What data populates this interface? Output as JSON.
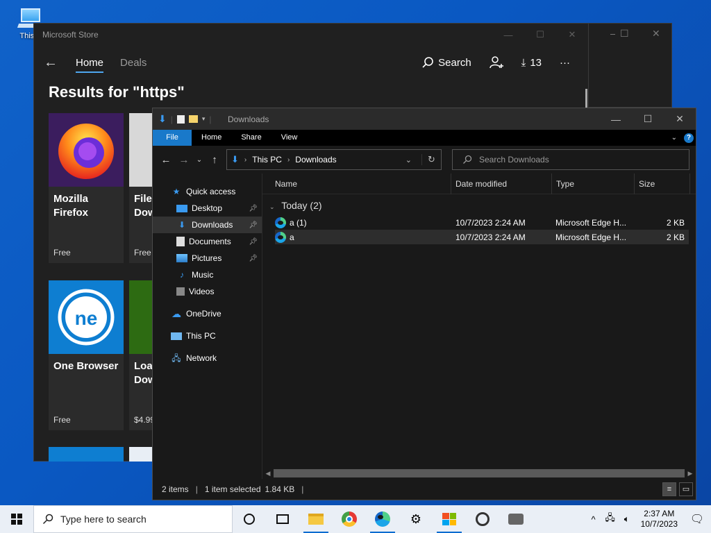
{
  "desktop": {
    "icon_label": "This P"
  },
  "store": {
    "title": "Microsoft Store",
    "tabs": [
      "Home",
      "Deals"
    ],
    "search_label": "Search",
    "downloads_count": "13",
    "results_heading": "Results for \"https\"",
    "tiles": [
      {
        "name1": "Mozilla",
        "name2": "Firefox",
        "price": "Free"
      },
      {
        "name1": "File",
        "name2": "Dow",
        "price": "Free"
      },
      {
        "name1": "One Browser",
        "name2": "",
        "price": "Free"
      },
      {
        "name1": "Load",
        "name2": "Dow",
        "price": "$4.99"
      }
    ]
  },
  "explorer": {
    "title": "Downloads",
    "ribbon_tabs": [
      "File",
      "Home",
      "Share",
      "View"
    ],
    "breadcrumb": [
      "This PC",
      "Downloads"
    ],
    "search_placeholder": "Search Downloads",
    "nav": {
      "quick_access": "Quick access",
      "desktop": "Desktop",
      "downloads": "Downloads",
      "documents": "Documents",
      "pictures": "Pictures",
      "music": "Music",
      "videos": "Videos",
      "onedrive": "OneDrive",
      "thispc": "This PC",
      "network": "Network"
    },
    "columns": [
      "Name",
      "Date modified",
      "Type",
      "Size"
    ],
    "group": "Today (2)",
    "files": [
      {
        "name": "a (1)",
        "date": "10/7/2023 2:24 AM",
        "type": "Microsoft Edge H...",
        "size": "2 KB"
      },
      {
        "name": "a",
        "date": "10/7/2023 2:24 AM",
        "type": "Microsoft Edge H...",
        "size": "2 KB"
      }
    ],
    "status": {
      "items": "2 items",
      "selected": "1 item selected",
      "size": "1.84 KB"
    }
  },
  "taskbar": {
    "search_placeholder": "Type here to search",
    "time": "2:37 AM",
    "date": "10/7/2023"
  },
  "colors": {
    "accent": "#1979ca",
    "store_link": "#4fa7f0"
  }
}
